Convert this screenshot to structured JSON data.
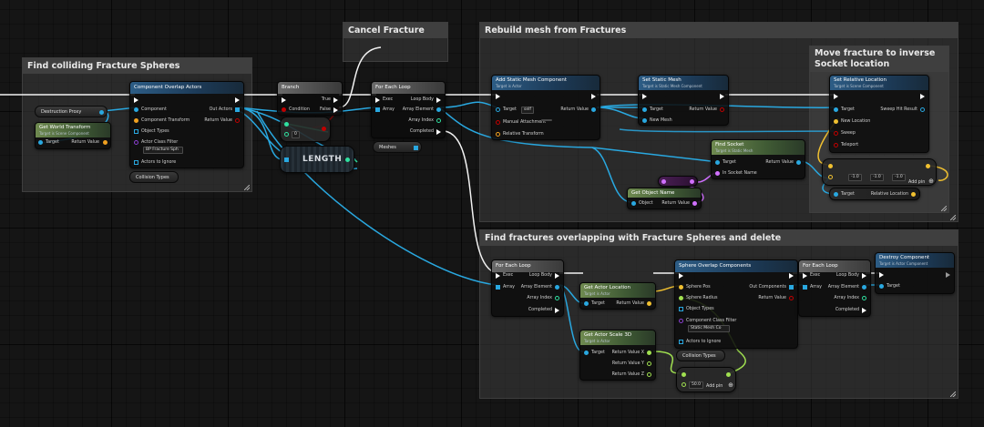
{
  "comments": {
    "find_colliding": "Find colliding Fracture Spheres",
    "cancel_fracture": "Cancel Fracture",
    "rebuild_mesh": "Rebuild mesh from Fractures",
    "move_fracture": "Move fracture to inverse Socket location",
    "find_overlapping": "Find fractures overlapping with Fracture Spheres and delete"
  },
  "nodes": {
    "destruction_proxy": "Destruction Proxy",
    "get_world_transform": {
      "title": "Get World Transform",
      "subtitle": "Target is Scene Component",
      "target": "Target",
      "return": "Return Value"
    },
    "component_overlap": {
      "title": "Component Overlap Actors",
      "component": "Component",
      "component_transform": "Component Transform",
      "object_types": "Object Types",
      "actor_class_filter": "Actor Class Filter",
      "actor_class_value": "BP Fracture Sph",
      "actors_to_ignore": "Actors to Ignore",
      "out_actors": "Out Actors",
      "return": "Return Value"
    },
    "collision_types": "Collision Types",
    "collision_types2": "Collision Types",
    "branch": {
      "title": "Branch",
      "condition": "Condition",
      "true": "True",
      "false": "False"
    },
    "compare_value": "0",
    "length": "LENGTH",
    "for_each_1": {
      "title": "For Each Loop",
      "exec": "Exec",
      "array": "Array",
      "loop_body": "Loop Body",
      "array_element": "Array Element",
      "array_index": "Array Index",
      "completed": "Completed"
    },
    "meshes": "Meshes",
    "add_static_mesh": {
      "title": "Add Static Mesh Component",
      "subtitle": "Target is Actor",
      "target": "Target",
      "target_value": "self",
      "manual_attachment": "Manual Attachment",
      "relative_transform": "Relative Transform",
      "return": "Return Value"
    },
    "set_static_mesh": {
      "title": "Set Static Mesh",
      "subtitle": "Target is Static Mesh Component",
      "target": "Target",
      "new_mesh": "New Mesh",
      "return": "Return Value"
    },
    "set_relative_location": {
      "title": "Set Relative Location",
      "subtitle": "Target is Scene Component",
      "target": "Target",
      "new_location": "New Location",
      "sweep": "Sweep",
      "teleport": "Teleport",
      "sweep_hit": "Sweep Hit Result"
    },
    "find_socket": {
      "title": "Find Socket",
      "subtitle": "Target is Static Mesh",
      "target": "Target",
      "in_socket_name": "In Socket Name",
      "return": "Return Value"
    },
    "get_object_name": {
      "title": "Get Object Name",
      "object": "Object",
      "return": "Return Value"
    },
    "multiply_vec": {
      "v1": "-1.0",
      "v2": "-1.0",
      "v3": "-1.0",
      "add_pin": "Add pin"
    },
    "relative_location": {
      "target": "Target",
      "relative_location": "Relative Location"
    },
    "for_each_2": {
      "title": "For Each Loop",
      "exec": "Exec",
      "array": "Array",
      "loop_body": "Loop Body",
      "array_element": "Array Element",
      "array_index": "Array Index",
      "completed": "Completed"
    },
    "get_actor_location": {
      "title": "Get Actor Location",
      "subtitle": "Target is Actor",
      "target": "Target",
      "return": "Return Value"
    },
    "get_actor_scale": {
      "title": "Get Actor Scale 3D",
      "subtitle": "Target is Actor",
      "target": "Target",
      "rx": "Return Value X",
      "ry": "Return Value Y",
      "rz": "Return Value Z"
    },
    "sphere_overlap": {
      "title": "Sphere Overlap Components",
      "sphere_pos": "Sphere Pos",
      "sphere_radius": "Sphere Radius",
      "object_types": "Object Types",
      "component_class_filter": "Component Class Filter",
      "class_value": "Static Mesh Co",
      "actors_to_ignore": "Actors to Ignore",
      "out_components": "Out Components",
      "return": "Return Value"
    },
    "multiply_float": {
      "value": "50.0",
      "add_pin": "Add pin"
    },
    "for_each_3": {
      "title": "For Each Loop",
      "exec": "Exec",
      "array": "Array",
      "loop_body": "Loop Body",
      "array_element": "Array Element",
      "array_index": "Array Index",
      "completed": "Completed"
    },
    "destroy_component": {
      "title": "Destroy Component",
      "subtitle": "Target is Actor Component",
      "target": "Target"
    }
  },
  "colors": {
    "exec": "#ffffff",
    "object": "#29a8e0",
    "struct": "#f0a020",
    "bool": "#c00000",
    "int": "#30e0a0",
    "name": "#d070ff",
    "vector": "#f0c030",
    "float": "#a0e050"
  }
}
